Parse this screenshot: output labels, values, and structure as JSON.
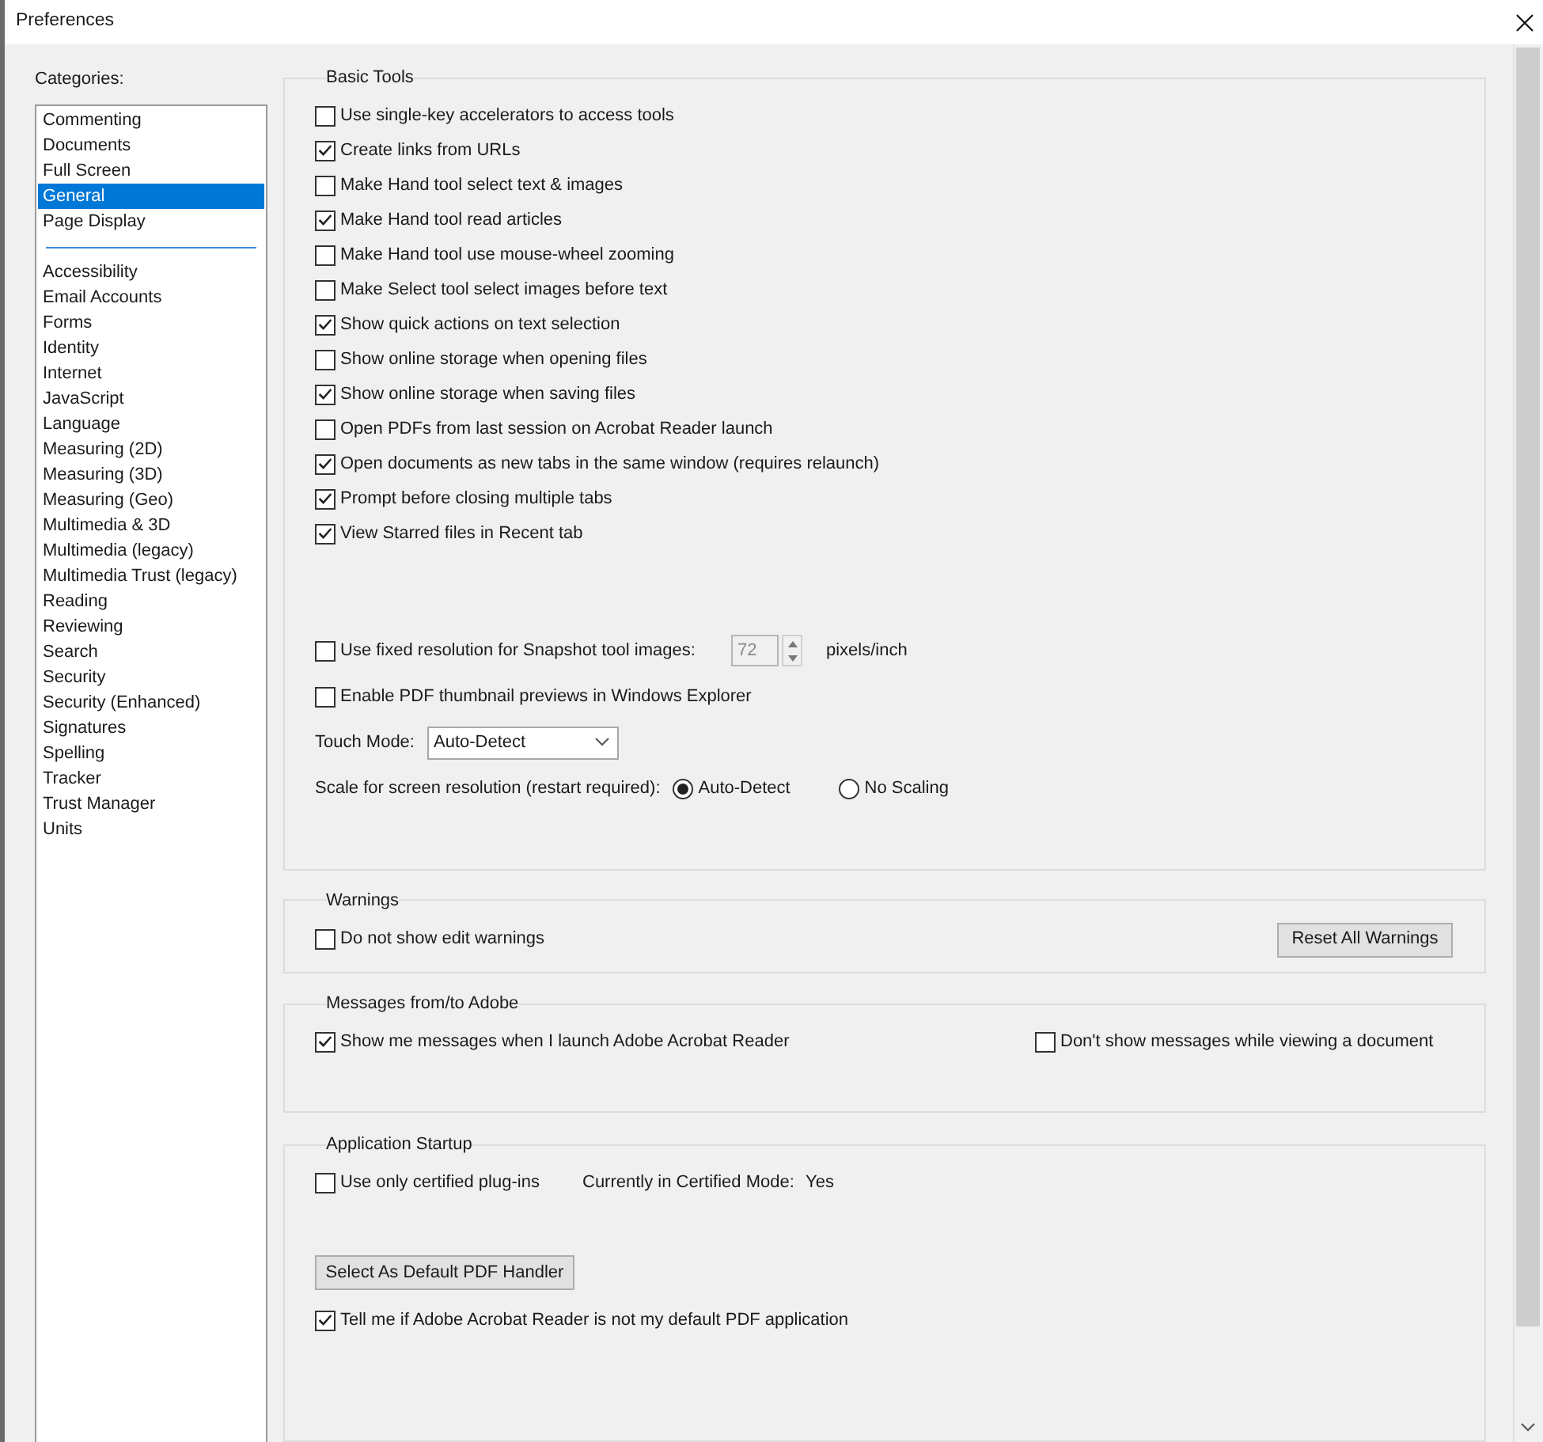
{
  "window": {
    "title": "Preferences"
  },
  "categories": {
    "label": "Categories:",
    "primary": [
      {
        "label": "Commenting",
        "selected": false
      },
      {
        "label": "Documents",
        "selected": false
      },
      {
        "label": "Full Screen",
        "selected": false
      },
      {
        "label": "General",
        "selected": true
      },
      {
        "label": "Page Display",
        "selected": false
      }
    ],
    "secondary": [
      {
        "label": "Accessibility",
        "selected": false
      },
      {
        "label": "Email Accounts",
        "selected": false
      },
      {
        "label": "Forms",
        "selected": false
      },
      {
        "label": "Identity",
        "selected": false
      },
      {
        "label": "Internet",
        "selected": false
      },
      {
        "label": "JavaScript",
        "selected": false
      },
      {
        "label": "Language",
        "selected": false
      },
      {
        "label": "Measuring (2D)",
        "selected": false
      },
      {
        "label": "Measuring (3D)",
        "selected": false
      },
      {
        "label": "Measuring (Geo)",
        "selected": false
      },
      {
        "label": "Multimedia & 3D",
        "selected": false
      },
      {
        "label": "Multimedia (legacy)",
        "selected": false
      },
      {
        "label": "Multimedia Trust (legacy)",
        "selected": false
      },
      {
        "label": "Reading",
        "selected": false
      },
      {
        "label": "Reviewing",
        "selected": false
      },
      {
        "label": "Search",
        "selected": false
      },
      {
        "label": "Security",
        "selected": false
      },
      {
        "label": "Security (Enhanced)",
        "selected": false
      },
      {
        "label": "Signatures",
        "selected": false
      },
      {
        "label": "Spelling",
        "selected": false
      },
      {
        "label": "Tracker",
        "selected": false
      },
      {
        "label": "Trust Manager",
        "selected": false
      },
      {
        "label": "Units",
        "selected": false
      }
    ]
  },
  "basic_tools": {
    "title": "Basic Tools",
    "options": [
      {
        "label": "Use single-key accelerators to access tools",
        "checked": false
      },
      {
        "label": "Create links from URLs",
        "checked": true
      },
      {
        "label": "Make Hand tool select text & images",
        "checked": false
      },
      {
        "label": "Make Hand tool read articles",
        "checked": true
      },
      {
        "label": "Make Hand tool use mouse-wheel zooming",
        "checked": false
      },
      {
        "label": "Make Select tool select images before text",
        "checked": false
      },
      {
        "label": "Show quick actions on text selection",
        "checked": true
      },
      {
        "label": "Show online storage when opening files",
        "checked": false
      },
      {
        "label": "Show online storage when saving files",
        "checked": true
      },
      {
        "label": "Open PDFs from last session on Acrobat Reader launch",
        "checked": false
      },
      {
        "label": "Open documents as new tabs in the same window (requires relaunch)",
        "checked": true
      },
      {
        "label": "Prompt before closing multiple tabs",
        "checked": true
      },
      {
        "label": "View Starred files in Recent tab",
        "checked": true
      }
    ],
    "snapshot": {
      "label": "Use fixed resolution for Snapshot tool images:",
      "checked": false,
      "value": "72",
      "disabled": true,
      "unit": "pixels/inch"
    },
    "thumbnails": {
      "label": "Enable PDF thumbnail previews in Windows Explorer",
      "checked": false
    },
    "touch_mode": {
      "label": "Touch Mode:",
      "value": "Auto-Detect"
    },
    "scale": {
      "label": "Scale for screen resolution (restart required):",
      "options": [
        {
          "label": "Auto-Detect",
          "selected": true
        },
        {
          "label": "No Scaling",
          "selected": false
        }
      ]
    }
  },
  "warnings": {
    "title": "Warnings",
    "option": {
      "label": "Do not show edit warnings",
      "checked": false
    },
    "button": "Reset All Warnings"
  },
  "messages": {
    "title": "Messages from/to Adobe",
    "options": [
      {
        "label": "Show me messages when I launch Adobe Acrobat Reader",
        "checked": true
      },
      {
        "label": "Don't show messages while viewing a document",
        "checked": false
      }
    ]
  },
  "startup": {
    "title": "Application Startup",
    "certified": {
      "label": "Use only certified plug-ins",
      "checked": false
    },
    "mode_label": "Currently in Certified Mode:",
    "mode_value": "Yes",
    "button": "Select As Default PDF Handler",
    "default_check": {
      "label": "Tell me if Adobe Acrobat Reader is not my default PDF application",
      "checked": true
    }
  }
}
